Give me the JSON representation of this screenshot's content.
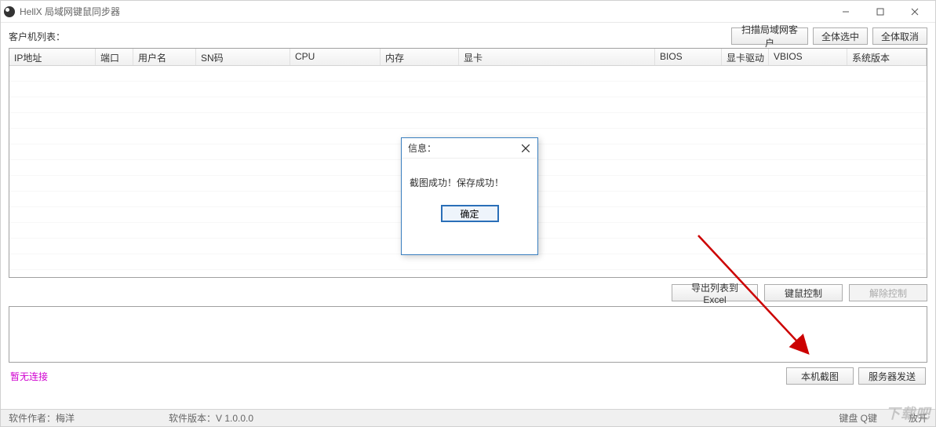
{
  "titlebar": {
    "title": "HellX 局域网键鼠同步器"
  },
  "top": {
    "list_label": "客户机列表：",
    "scan": "扫描局域网客户",
    "select_all": "全体选中",
    "deselect_all": "全体取消"
  },
  "columns": {
    "ip": "IP地址",
    "port": "端口",
    "user": "用户名",
    "sn": "SN码",
    "cpu": "CPU",
    "mem": "内存",
    "gpu": "显卡",
    "bios": "BIOS",
    "gpu_drv": "显卡驱动",
    "vbios": "VBIOS",
    "os": "系统版本"
  },
  "mid": {
    "export": "导出列表到Excel",
    "control": "键鼠控制",
    "release": "解除控制"
  },
  "bottom": {
    "status": "暂无连接",
    "capture": "本机截图",
    "send": "服务器发送"
  },
  "statusbar": {
    "author": "软件作者：梅洋",
    "version": "软件版本：V 1.0.0.0",
    "keyboard": "键盘 Q键",
    "release": "放开"
  },
  "dialog": {
    "title": "信息：",
    "message": "截图成功！保存成功！",
    "ok": "确定"
  },
  "watermark": "下载吧"
}
